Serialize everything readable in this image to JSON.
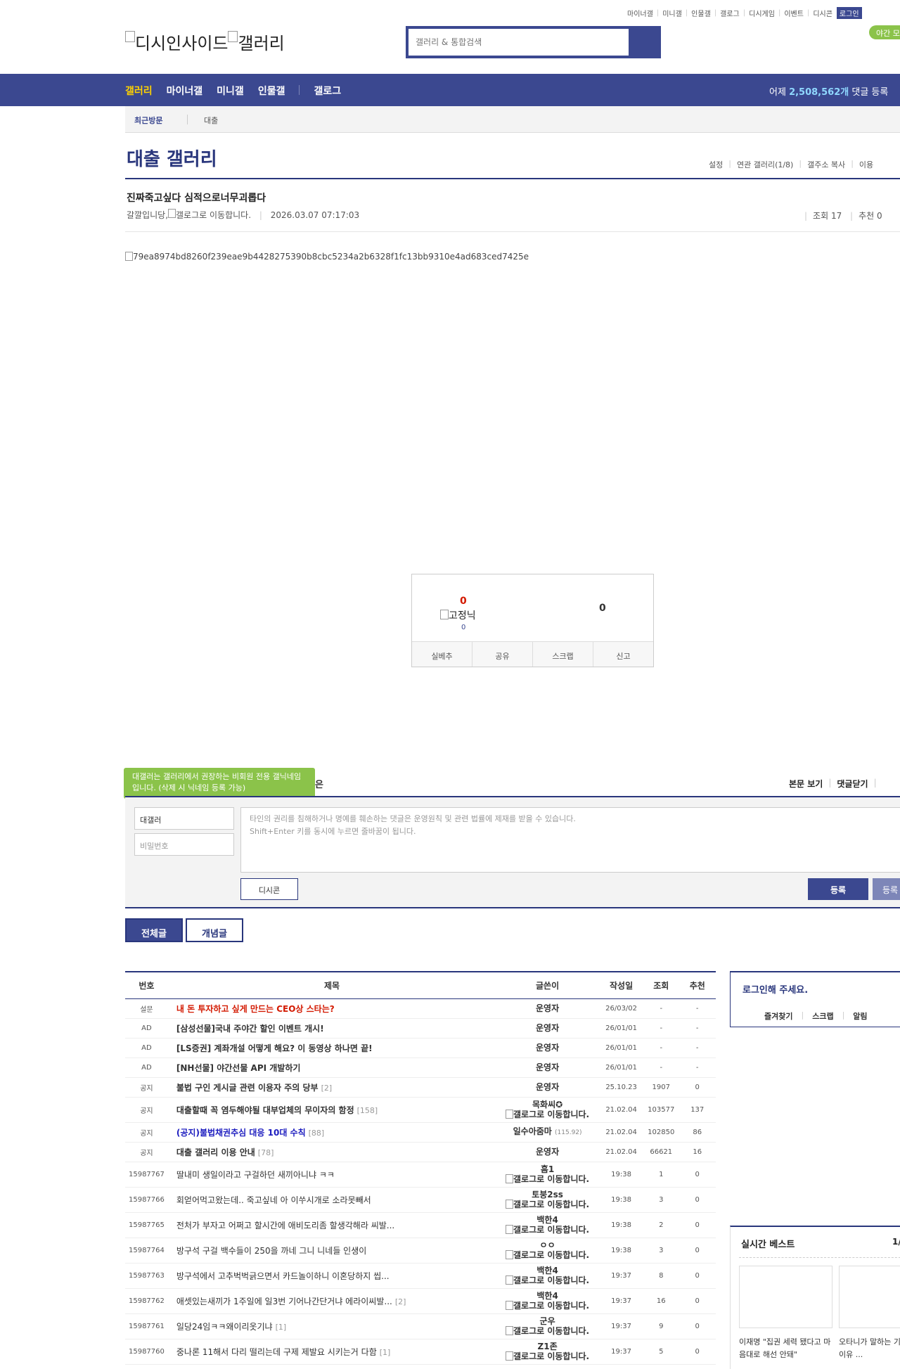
{
  "top_links": [
    "마이너갤",
    "미니갤",
    "인물갤",
    "갤로그",
    "디시게임",
    "이벤트",
    "디시콘"
  ],
  "login_label": "로그인",
  "night_mode": "야간 모",
  "logo": {
    "site": "디시인사이드",
    "gallery": "갤러리"
  },
  "search": {
    "placeholder": "갤러리 & 통합검색"
  },
  "gnb": {
    "items": [
      "갤러리",
      "마이너갤",
      "미니갤",
      "인물갤"
    ],
    "gallog": "갤로그",
    "stat_prefix": "어제",
    "stat_value": "2,508,562개",
    "stat_suffix": "댓글 등록"
  },
  "recent": {
    "label": "최근방문",
    "item": "대출"
  },
  "gallery": {
    "title": "대출 갤러리",
    "tools": [
      "설정",
      "연관 갤러리(1/8)",
      "갤주소 복사",
      "이용"
    ]
  },
  "post": {
    "title": "진짜죽고싶다 심적으로너무괴롭다",
    "author": "갈깔입니당,",
    "author_icon_alt": "갤로그로 이동합니다.",
    "date": "2026.03.07 07:17:03",
    "views": "조회 17",
    "recommend": "추천 0",
    "image_alt": "79ea8974bd8260f239eae9b4428275390b8cbc5234a2b6328f1fc13bb9310e4ad683ced7425e"
  },
  "vote": {
    "up": "0",
    "fixed_alt": "고정닉",
    "fixed_count": "0",
    "down": "0",
    "buttons": [
      "실베추",
      "공유",
      "스크랩",
      "신고"
    ]
  },
  "comment": {
    "tooltip": "대갤러는 갤러리에서 권장하는 비회원 전용 갤닉네임입니다. (삭제 시 닉네임 등록 가능)",
    "tail": "은",
    "options": [
      "본문 보기",
      "댓글닫기"
    ],
    "nick": "대갤러",
    "password_placeholder": "비밀번호",
    "textarea_line1": "타인의 권리를 침해하거나 명예를 훼손하는 댓글은 운영원칙 및 관련 법률에 제재를 받을 수 있습니다.",
    "textarea_line2": "Shift+Enter 키를 동시에 누르면 줄바꿈이 됩니다.",
    "dccon": "디시콘",
    "submit": "등록",
    "submit2": "등록"
  },
  "tabs": [
    "전체글",
    "개념글"
  ],
  "list": {
    "headers": [
      "번호",
      "제목",
      "글쓴이",
      "작성일",
      "조회",
      "추천"
    ],
    "rows": [
      {
        "num": "설문",
        "title": "내 돈 투자하고 싶게 만드는 CEO상 스타는?",
        "style": "red",
        "cnt": "",
        "writer": "운영자",
        "sub": "",
        "date": "26/03/02",
        "view": "-",
        "rec": "-"
      },
      {
        "num": "AD",
        "title": "[삼성선물]국내 주야간 할인 이벤트 개시!",
        "style": "bold",
        "cnt": "",
        "writer": "운영자",
        "sub": "",
        "date": "26/01/01",
        "view": "-",
        "rec": "-"
      },
      {
        "num": "AD",
        "title": "[LS증권] 계좌개설 어떻게 해요? 이 동영상 하나면 끝!",
        "style": "bold",
        "cnt": "",
        "writer": "운영자",
        "sub": "",
        "date": "26/01/01",
        "view": "-",
        "rec": "-"
      },
      {
        "num": "AD",
        "title": "[NH선물] 야간선물 API 개발하기",
        "style": "bold",
        "cnt": "",
        "writer": "운영자",
        "sub": "",
        "date": "26/01/01",
        "view": "-",
        "rec": "-"
      },
      {
        "num": "공지",
        "title": "불법 구인 게시글 관련 이용자 주의 당부",
        "style": "bold",
        "cnt": "[2]",
        "writer": "운영자",
        "sub": "",
        "date": "25.10.23",
        "view": "1907",
        "rec": "0"
      },
      {
        "num": "공지",
        "title": "대출할때 꼭 염두해야될 대부업체의 무이자의 함정",
        "style": "bold",
        "cnt": "[158]",
        "writer": "목화씨✪",
        "sub": "갤로그로 이동합니다.",
        "date": "21.02.04",
        "view": "103577",
        "rec": "137"
      },
      {
        "num": "공지",
        "title": "(공지)불법채권추심 대응 10대 수칙",
        "style": "blue",
        "cnt": "[88]",
        "writer": "일수아줌마",
        "wsub": "(115.92)",
        "sub": "",
        "date": "21.02.04",
        "view": "102850",
        "rec": "86"
      },
      {
        "num": "공지",
        "title": "대출 갤러리 이용 안내",
        "style": "bold",
        "cnt": "[78]",
        "writer": "운영자",
        "sub": "",
        "date": "21.02.04",
        "view": "66621",
        "rec": "16"
      },
      {
        "num": "15987767",
        "title": "딸내미 생일이라고 구걸하던 새끼아니냐 ㅋㅋ",
        "style": "",
        "cnt": "",
        "writer": "흠1",
        "sub": "갤로그로 이동합니다.",
        "date": "19:38",
        "view": "1",
        "rec": "0"
      },
      {
        "num": "15987766",
        "title": "회얻어먹고왔는데.. 죽고싶네 아 이쑤시개로 소라못빼서",
        "style": "",
        "cnt": "",
        "writer": "토붕2ss",
        "sub": "갤로그로 이동합니다.",
        "date": "19:38",
        "view": "3",
        "rec": "0"
      },
      {
        "num": "15987765",
        "title": "전처가 부자고 어쩌고 할시간에 애비도리좀 할생각해라 씨발...",
        "style": "",
        "cnt": "",
        "writer": "백한4",
        "sub": "갤로그로 이동합니다.",
        "date": "19:38",
        "view": "2",
        "rec": "0"
      },
      {
        "num": "15987764",
        "title": "방구석 구걸 백수들이 250을 까네 그니 니네들 인생이",
        "style": "",
        "cnt": "",
        "writer": "ㅇㅇ",
        "sub": "갤로그로 이동합니다.",
        "date": "19:38",
        "view": "3",
        "rec": "0"
      },
      {
        "num": "15987763",
        "title": "방구석에서 고추벅벅긁으면서 카드놀이하니 이혼당하지 씹...",
        "style": "",
        "cnt": "",
        "writer": "백한4",
        "sub": "갤로그로 이동합니다.",
        "date": "19:37",
        "view": "8",
        "rec": "0"
      },
      {
        "num": "15987762",
        "title": "애셋있는새끼가 1주일에 일3번 기어나간단거냐 에라이씨발...",
        "style": "",
        "cnt": "[2]",
        "writer": "백한4",
        "sub": "갤로그로 이동합니다.",
        "date": "19:37",
        "view": "16",
        "rec": "0"
      },
      {
        "num": "15987761",
        "title": "일당24임ㅋㅋ왜이리옷기냐",
        "style": "",
        "cnt": "[1]",
        "writer": "군우",
        "sub": "갤로그로 이동합니다.",
        "date": "19:37",
        "view": "9",
        "rec": "0"
      },
      {
        "num": "15987760",
        "title": "중나론 11해서 다리 떨리는데 구제 제발요 시키는거 다함",
        "style": "",
        "cnt": "[1]",
        "writer": "Z1존",
        "sub": "갤로그로 이동합니다.",
        "date": "19:37",
        "view": "5",
        "rec": "0"
      }
    ]
  },
  "loginbox": {
    "title": "로그인해 주세요.",
    "links": [
      "즐겨찾기",
      "스크랩",
      "알림"
    ]
  },
  "best": {
    "title": "실시간 베스트",
    "page": "1/",
    "items": [
      {
        "caption": "이재명 \"집권 세력 됐다고 마음대로 해선 안돼\""
      },
      {
        "caption": "오타니가 말하는 기를 줍는 이유 ..."
      }
    ]
  },
  "colors": {
    "brand": "#3b4890",
    "brand_dark": "#29367c",
    "accent_yellow": "#ffd200",
    "notice_red": "#d31900",
    "tooltip_green": "#8bc34a"
  }
}
